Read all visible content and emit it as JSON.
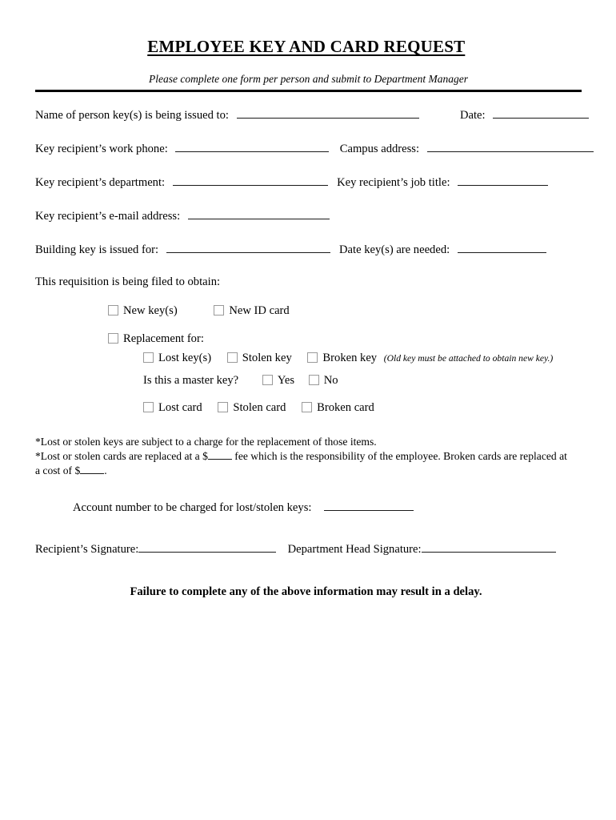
{
  "document": {
    "title": "EMPLOYEE KEY AND CARD REQUEST",
    "subtitle": "Please complete one form per person and submit to Department Manager"
  },
  "fields": {
    "name_label": "Name of person key(s) is being issued to:",
    "date_label": "Date:",
    "work_phone_label": "Key recipient’s work phone:",
    "campus_address_label": "Campus address:",
    "department_label": "Key recipient’s department:",
    "job_title_label": "Key recipient’s job title:",
    "email_label": "Key recipient’s e-mail address:",
    "building_key_label": "Building key is issued for:",
    "date_needed_label": "Date key(s) are needed:"
  },
  "requisition": {
    "heading": "This requisition is being filed to obtain:",
    "new_options": [
      {
        "label": "New key(s)"
      },
      {
        "label": "New ID card"
      }
    ],
    "replacement_label": "Replacement for:",
    "key_options": [
      {
        "label": "Lost key(s)"
      },
      {
        "label": "Stolen key"
      },
      {
        "label": "Broken key"
      }
    ],
    "broken_key_note": "(Old key must be attached to obtain new key.)",
    "master_key_question": "Is this a master key?",
    "master_key_options": [
      {
        "label": "Yes"
      },
      {
        "label": "No"
      }
    ],
    "card_options": [
      {
        "label": "Lost card"
      },
      {
        "label": "Stolen card"
      },
      {
        "label": "Broken card"
      }
    ]
  },
  "footnotes": {
    "line1": "*Lost or stolen keys are subject to a charge for the replacement of those items.",
    "line2_a": "*Lost or stolen cards are replaced at a $",
    "line2_b": " fee which is the responsibility of the employee.  Broken cards are replaced at",
    "line3_a": "a cost of $",
    "line3_b": ".",
    "account_label": "Account number to be charged for lost/stolen keys:"
  },
  "signatures": {
    "recipient_label": "Recipient’s Signature:",
    "department_head_label": "Department Head Signature:"
  },
  "closing": {
    "text": "Failure to complete any of the above information may result in a delay."
  }
}
